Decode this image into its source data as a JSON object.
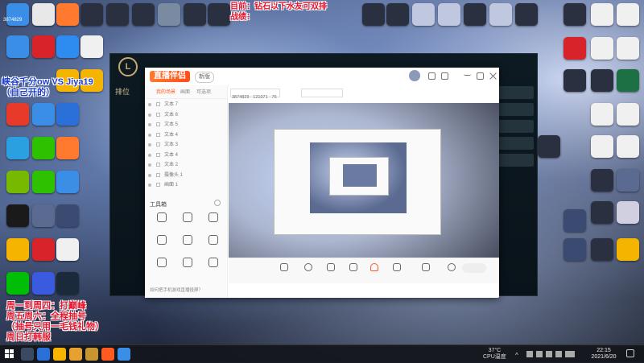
{
  "desktop": {
    "overlay_top": [
      "目前：钻石以下水友可双排",
      "战绩："
    ],
    "overlay_left_1": [
      "峡谷千分ow VS Jiya19",
      "（自己开的）"
    ],
    "overlay_left_2": [
      "周一到周四：打巅峰",
      "周五周六：全程抽号",
      "（抽号只用一毛钱礼物）",
      "周日打韩服"
    ],
    "top_left_number": "3874829"
  },
  "lol_client": {
    "side_label": "排位"
  },
  "obs_app": {
    "logo": "直播伴侣",
    "version": "新版",
    "scene_tabs": [
      "我的场景",
      "画面",
      "可选项"
    ],
    "scenes": [
      "文本 7",
      "文本 6",
      "文本 5",
      "文本 4",
      "文本 3",
      "文本 4",
      "文本 2",
      "摄像头 1",
      "画面 1"
    ],
    "toolbox_label": "工具箱",
    "tools": [
      {
        "icon": "camera-icon"
      },
      {
        "icon": "user-icon"
      },
      {
        "icon": "task-icon"
      },
      {
        "icon": "monitor-icon"
      },
      {
        "icon": "download-icon"
      },
      {
        "icon": "document-icon"
      },
      {
        "icon": "gift-icon"
      },
      {
        "icon": "image-icon"
      },
      {
        "icon": "data-icon"
      },
      {
        "icon": "game-icon"
      },
      {
        "icon": "link-icon"
      },
      {
        "icon": "more-icon"
      }
    ],
    "tip": "如何把手机游戏直播投屏？",
    "preview_info": "3874829 · 121071 · 76",
    "controls": [
      {
        "icon": "screen-icon"
      },
      {
        "icon": "camera-icon"
      },
      {
        "icon": "mobile-icon"
      },
      {
        "icon": "window-icon"
      },
      {
        "icon": "mic-icon"
      },
      {
        "icon": "speaker-icon"
      }
    ]
  },
  "taskbar": {
    "temp": "37°C",
    "cpu_label": "CPU温度",
    "time": "22:15",
    "date": "2021/6/20"
  },
  "colors": {
    "accent": "#ff5a1f",
    "overlay_red": "#e8122b",
    "overlay_blue": "#1a3ccf"
  }
}
